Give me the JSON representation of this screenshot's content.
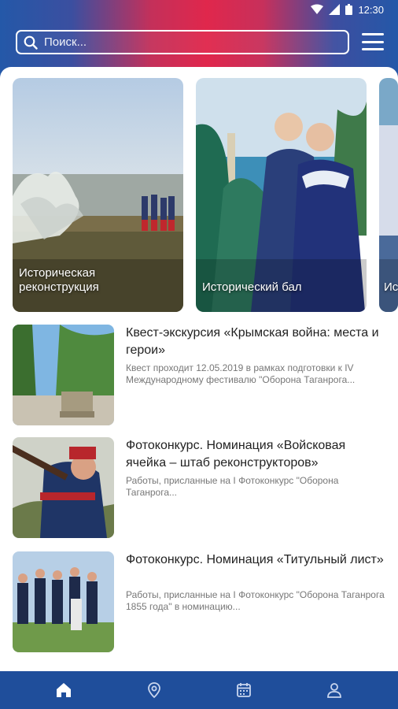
{
  "status": {
    "time": "12:30"
  },
  "search": {
    "placeholder": "Поиск..."
  },
  "featured": [
    {
      "label": "Историческая реконструкция"
    },
    {
      "label": "Исторический бал"
    },
    {
      "label": "Ис"
    }
  ],
  "list": [
    {
      "title": "Квест-экскурсия «Крымская война: места и герои»",
      "description": "Квест проходит 12.05.2019 в рамках подготовки к IV Международному фестивалю \"Оборона Таганрога..."
    },
    {
      "title": "Фотоконкурс. Номинация «Войсковая ячейка – штаб реконструкторов»",
      "description": "Работы, присланные на I Фотоконкурс \"Оборона Таганрога..."
    },
    {
      "title": "Фотоконкурс. Номинация «Титульный лист»",
      "description": "Работы, присланные на I Фотоконкурс \"Оборона Таганрога 1855 года\" в номинацию..."
    }
  ],
  "nav": [
    "home-icon",
    "map-pin-icon",
    "calendar-icon",
    "profile-icon"
  ],
  "colors": {
    "brand_blue": "#1f4e9b",
    "brand_red": "#e0274c"
  }
}
